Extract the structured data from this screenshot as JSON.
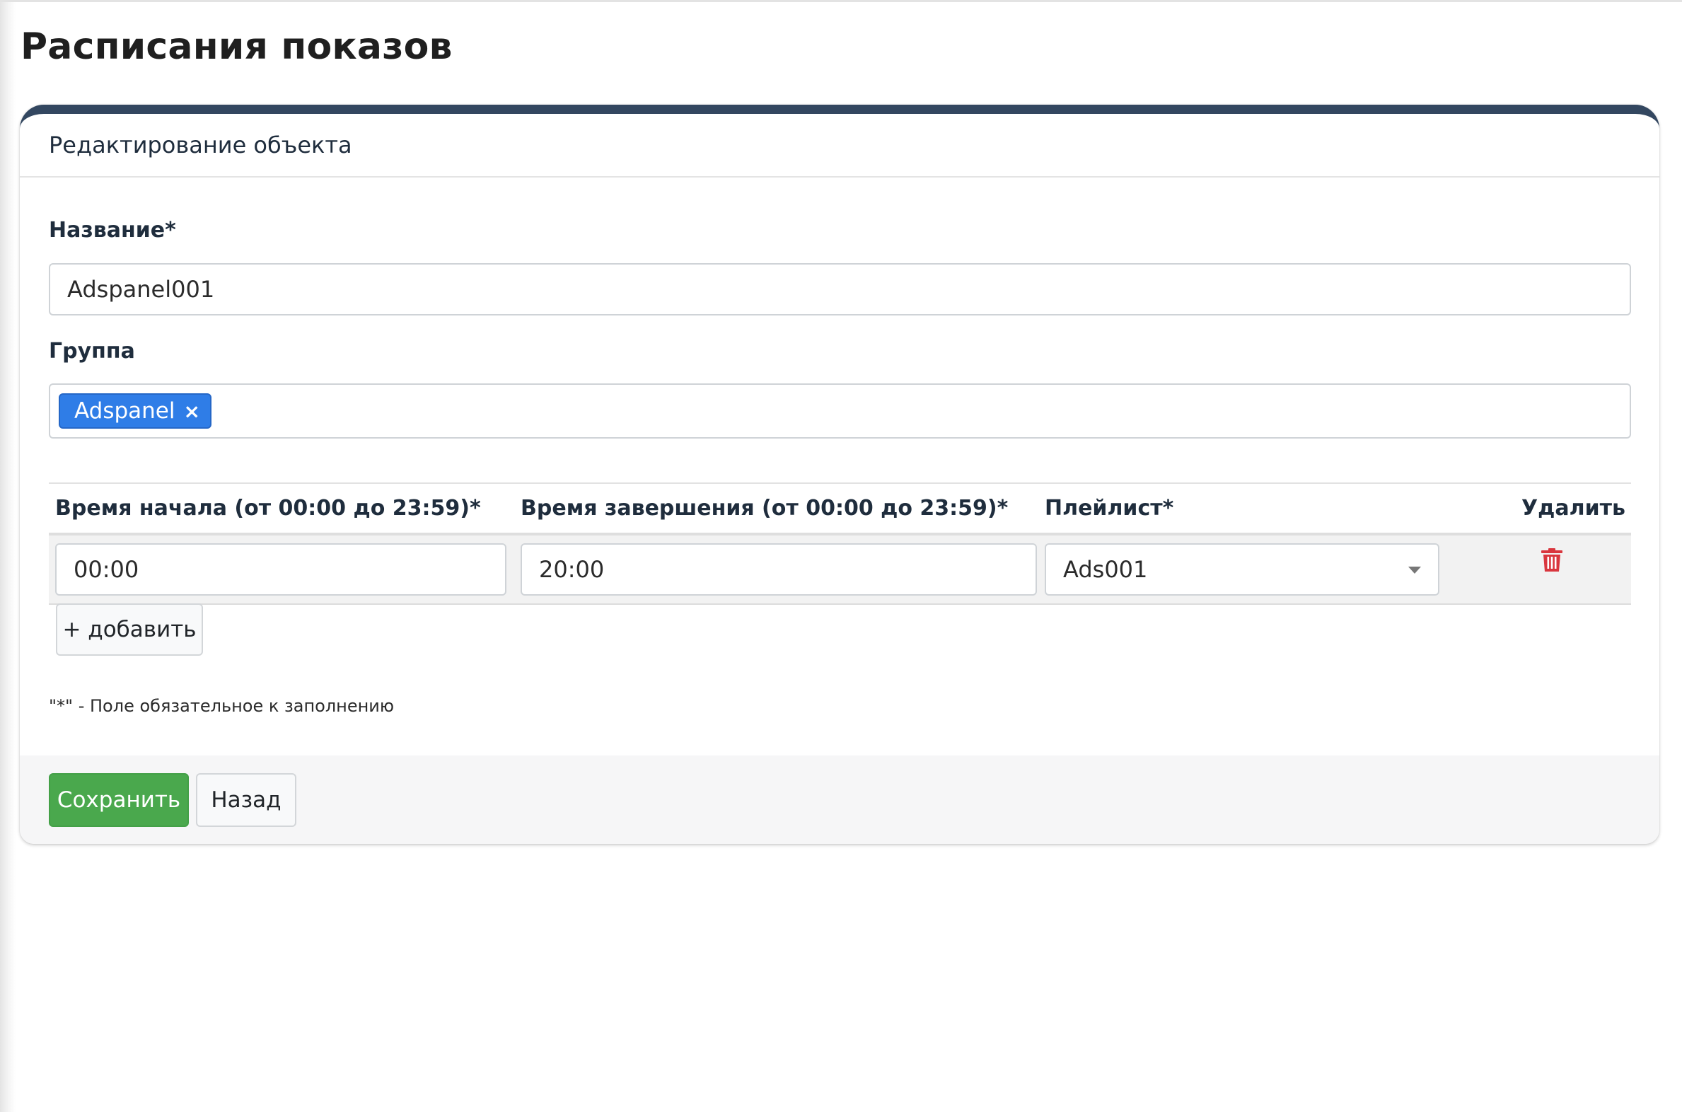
{
  "page": {
    "title": "Расписания показов"
  },
  "card": {
    "header_title": "Редактирование объекта"
  },
  "form": {
    "name_label": "Название*",
    "name_value": "Adspanel001",
    "group_label": "Группа",
    "group_tags": [
      {
        "label": "Adspanel",
        "remove_symbol": "×"
      }
    ]
  },
  "schedule": {
    "columns": {
      "start": "Время начала (от 00:00 до 23:59)*",
      "end": "Время завершения (от 00:00 до 23:59)*",
      "playlist": "Плейлист*",
      "delete": "Удалить"
    },
    "rows": [
      {
        "start": "00:00",
        "end": "20:00",
        "playlist": "Ads001"
      }
    ],
    "add_button": "+ добавить"
  },
  "note": "\"*\" - Поле обязательное к заполнению",
  "footer": {
    "save_button": "Сохранить",
    "back_button": "Назад"
  },
  "icons": {
    "tag_remove": "close-icon",
    "dropdown": "chevron-down-icon",
    "delete": "trash-icon"
  },
  "colors": {
    "card_accent": "#334760",
    "tag_bg": "#2f7de7",
    "save_bg": "#4aa84d",
    "delete_icon": "#d9363e"
  }
}
